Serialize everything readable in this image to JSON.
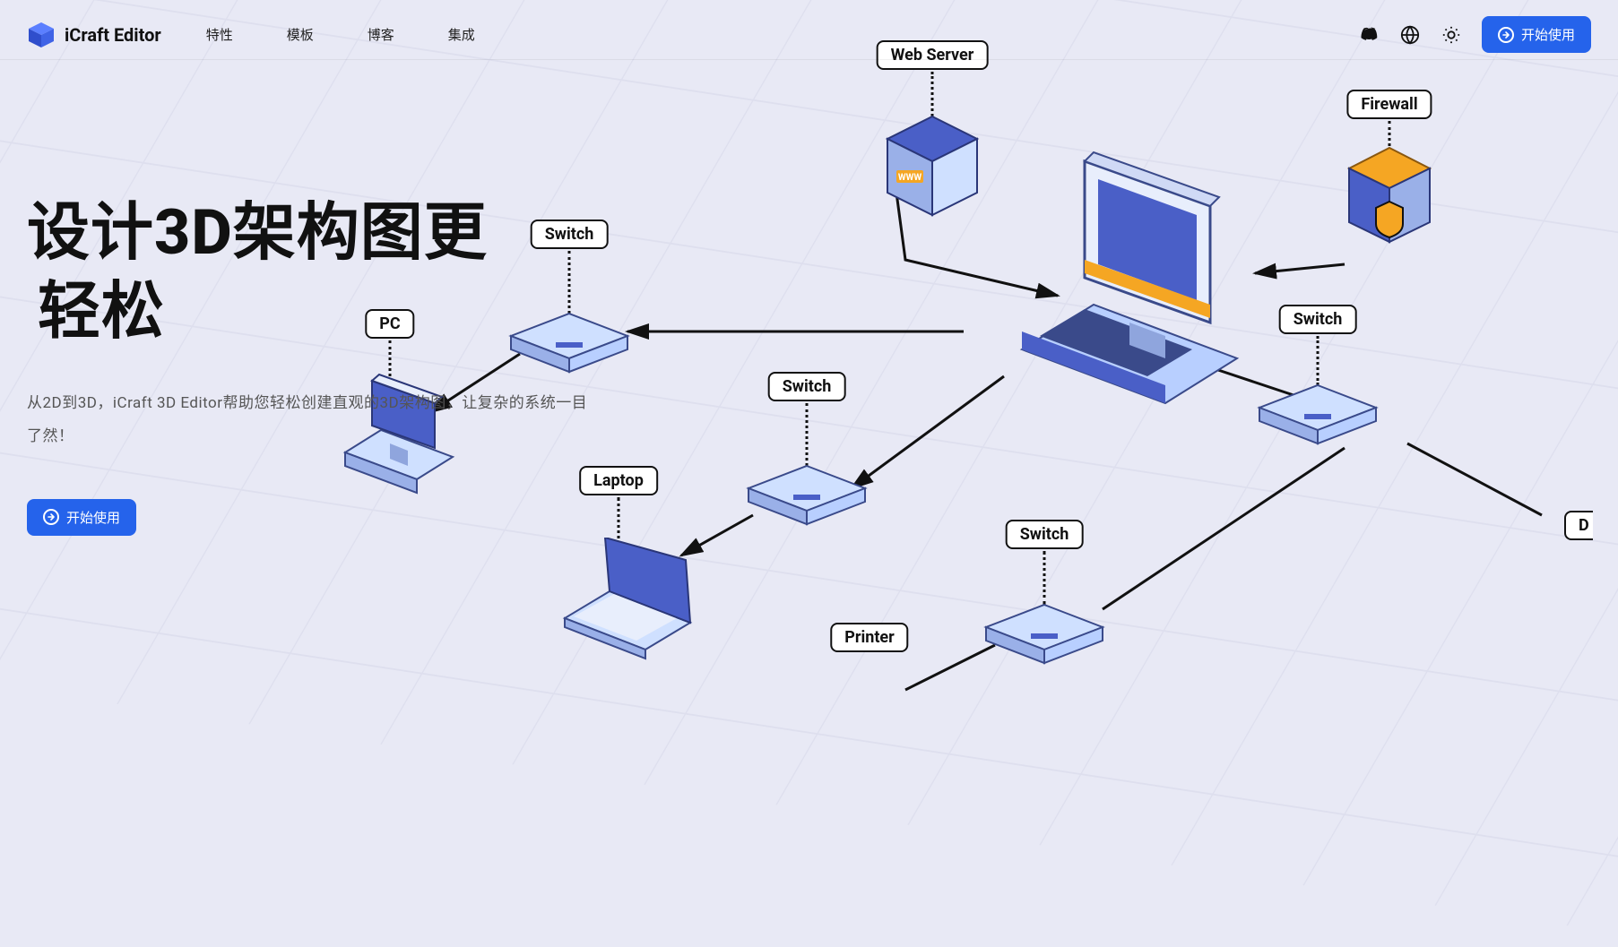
{
  "brand": {
    "name": "iCraft Editor"
  },
  "nav": {
    "items": [
      "特性",
      "模板",
      "博客",
      "集成"
    ]
  },
  "header_cta": {
    "label": "开始使用"
  },
  "hero": {
    "title_line1": "设计3D架构图更",
    "title_line2": "轻松",
    "description": "从2D到3D，iCraft 3D Editor帮助您轻松创建直观的3D架构图，让复杂的系统一目了然！",
    "cta_label": "开始使用"
  },
  "diagram": {
    "nodes": {
      "web_server": "Web Server",
      "firewall": "Firewall",
      "switch": "Switch",
      "pc": "PC",
      "laptop": "Laptop",
      "printer": "Printer",
      "d": "D"
    }
  }
}
